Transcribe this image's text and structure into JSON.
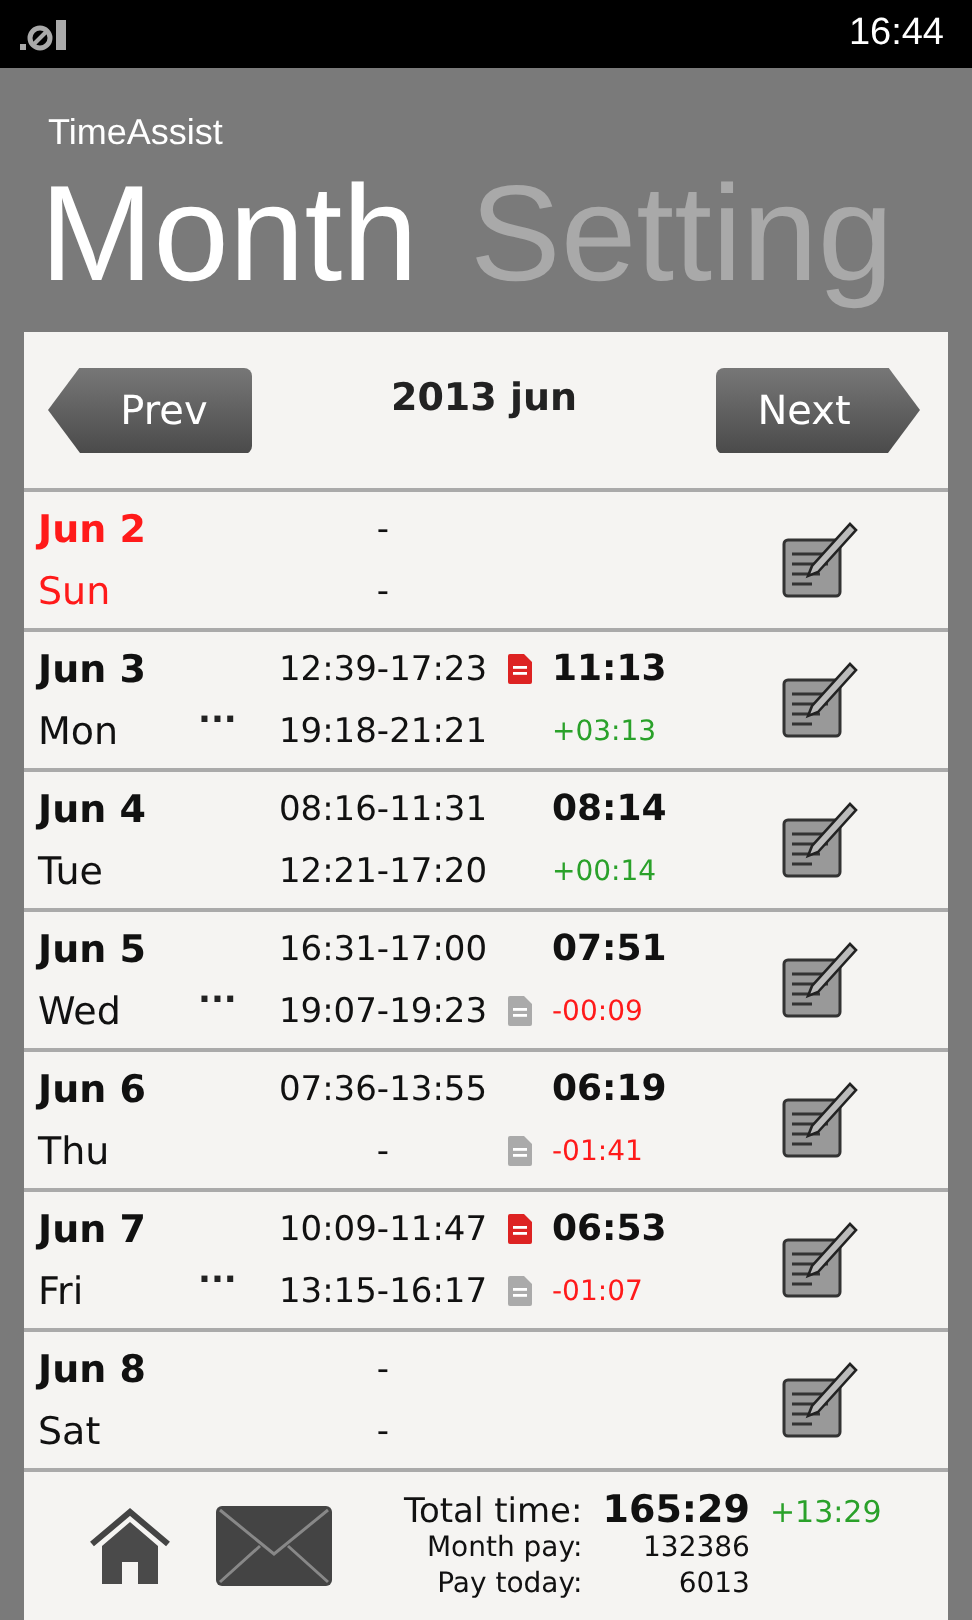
{
  "status_bar": {
    "time": "16:44"
  },
  "app_title": "TimeAssist",
  "pivot": [
    {
      "label": "Month",
      "selected": true
    },
    {
      "label": "Setting",
      "selected": false
    }
  ],
  "nav": {
    "prev": "Prev",
    "title": "2013 jun",
    "next": "Next"
  },
  "days": [
    {
      "date": "Jun 2",
      "weekday": "Sun",
      "weekend": true,
      "intervals": [
        {
          "text": "-",
          "kind": "plain"
        },
        {
          "text": "-",
          "kind": "plain"
        }
      ]
    },
    {
      "date": "Jun 3",
      "weekday": "Mon",
      "weekend": false,
      "more": "...",
      "intervals": [
        {
          "text": "12:39-17:23",
          "kind": "flagged"
        },
        {
          "text": "19:18-21:21",
          "kind": "plain"
        }
      ],
      "total": "11:13",
      "diff": {
        "text": "+03:13",
        "color": "#2aa12a"
      }
    },
    {
      "date": "Jun 4",
      "weekday": "Tue",
      "weekend": false,
      "intervals": [
        {
          "text": "08:16-11:31",
          "kind": "plain"
        },
        {
          "text": "12:21-17:20",
          "kind": "plain"
        }
      ],
      "total": "08:14",
      "diff": {
        "text": "+00:14",
        "color": "#2aa12a"
      }
    },
    {
      "date": "Jun 5",
      "weekday": "Wed",
      "weekend": false,
      "more": "...",
      "intervals": [
        {
          "text": "16:31-17:00",
          "kind": "plain"
        },
        {
          "text": "19:07-19:23",
          "kind": "noted"
        }
      ],
      "total": "07:51",
      "diff": {
        "text": "-00:09",
        "color": "#ff1a1a"
      }
    },
    {
      "date": "Jun 6",
      "weekday": "Thu",
      "weekend": false,
      "intervals": [
        {
          "text": "07:36-13:55",
          "kind": "plain"
        },
        {
          "text": "-",
          "kind": "noted"
        }
      ],
      "total": "06:19",
      "diff": {
        "text": "-01:41",
        "color": "#ff1a1a"
      }
    },
    {
      "date": "Jun 7",
      "weekday": "Fri",
      "weekend": false,
      "more": "...",
      "intervals": [
        {
          "text": "10:09-11:47",
          "kind": "flagged"
        },
        {
          "text": "13:15-16:17",
          "kind": "noted"
        }
      ],
      "total": "06:53",
      "diff": {
        "text": "-01:07",
        "color": "#ff1a1a"
      }
    },
    {
      "date": "Jun 8",
      "weekday": "Sat",
      "weekend": false,
      "intervals": [
        {
          "text": "-",
          "kind": "plain"
        },
        {
          "text": "-",
          "kind": "plain"
        }
      ]
    }
  ],
  "summary": {
    "total_label": "Total time:",
    "total": "165:29",
    "total_diff": "+13:29",
    "month_pay_label": "Month pay:",
    "month_pay": "132386",
    "pay_today_label": "Pay today:",
    "pay_today": "6013"
  }
}
